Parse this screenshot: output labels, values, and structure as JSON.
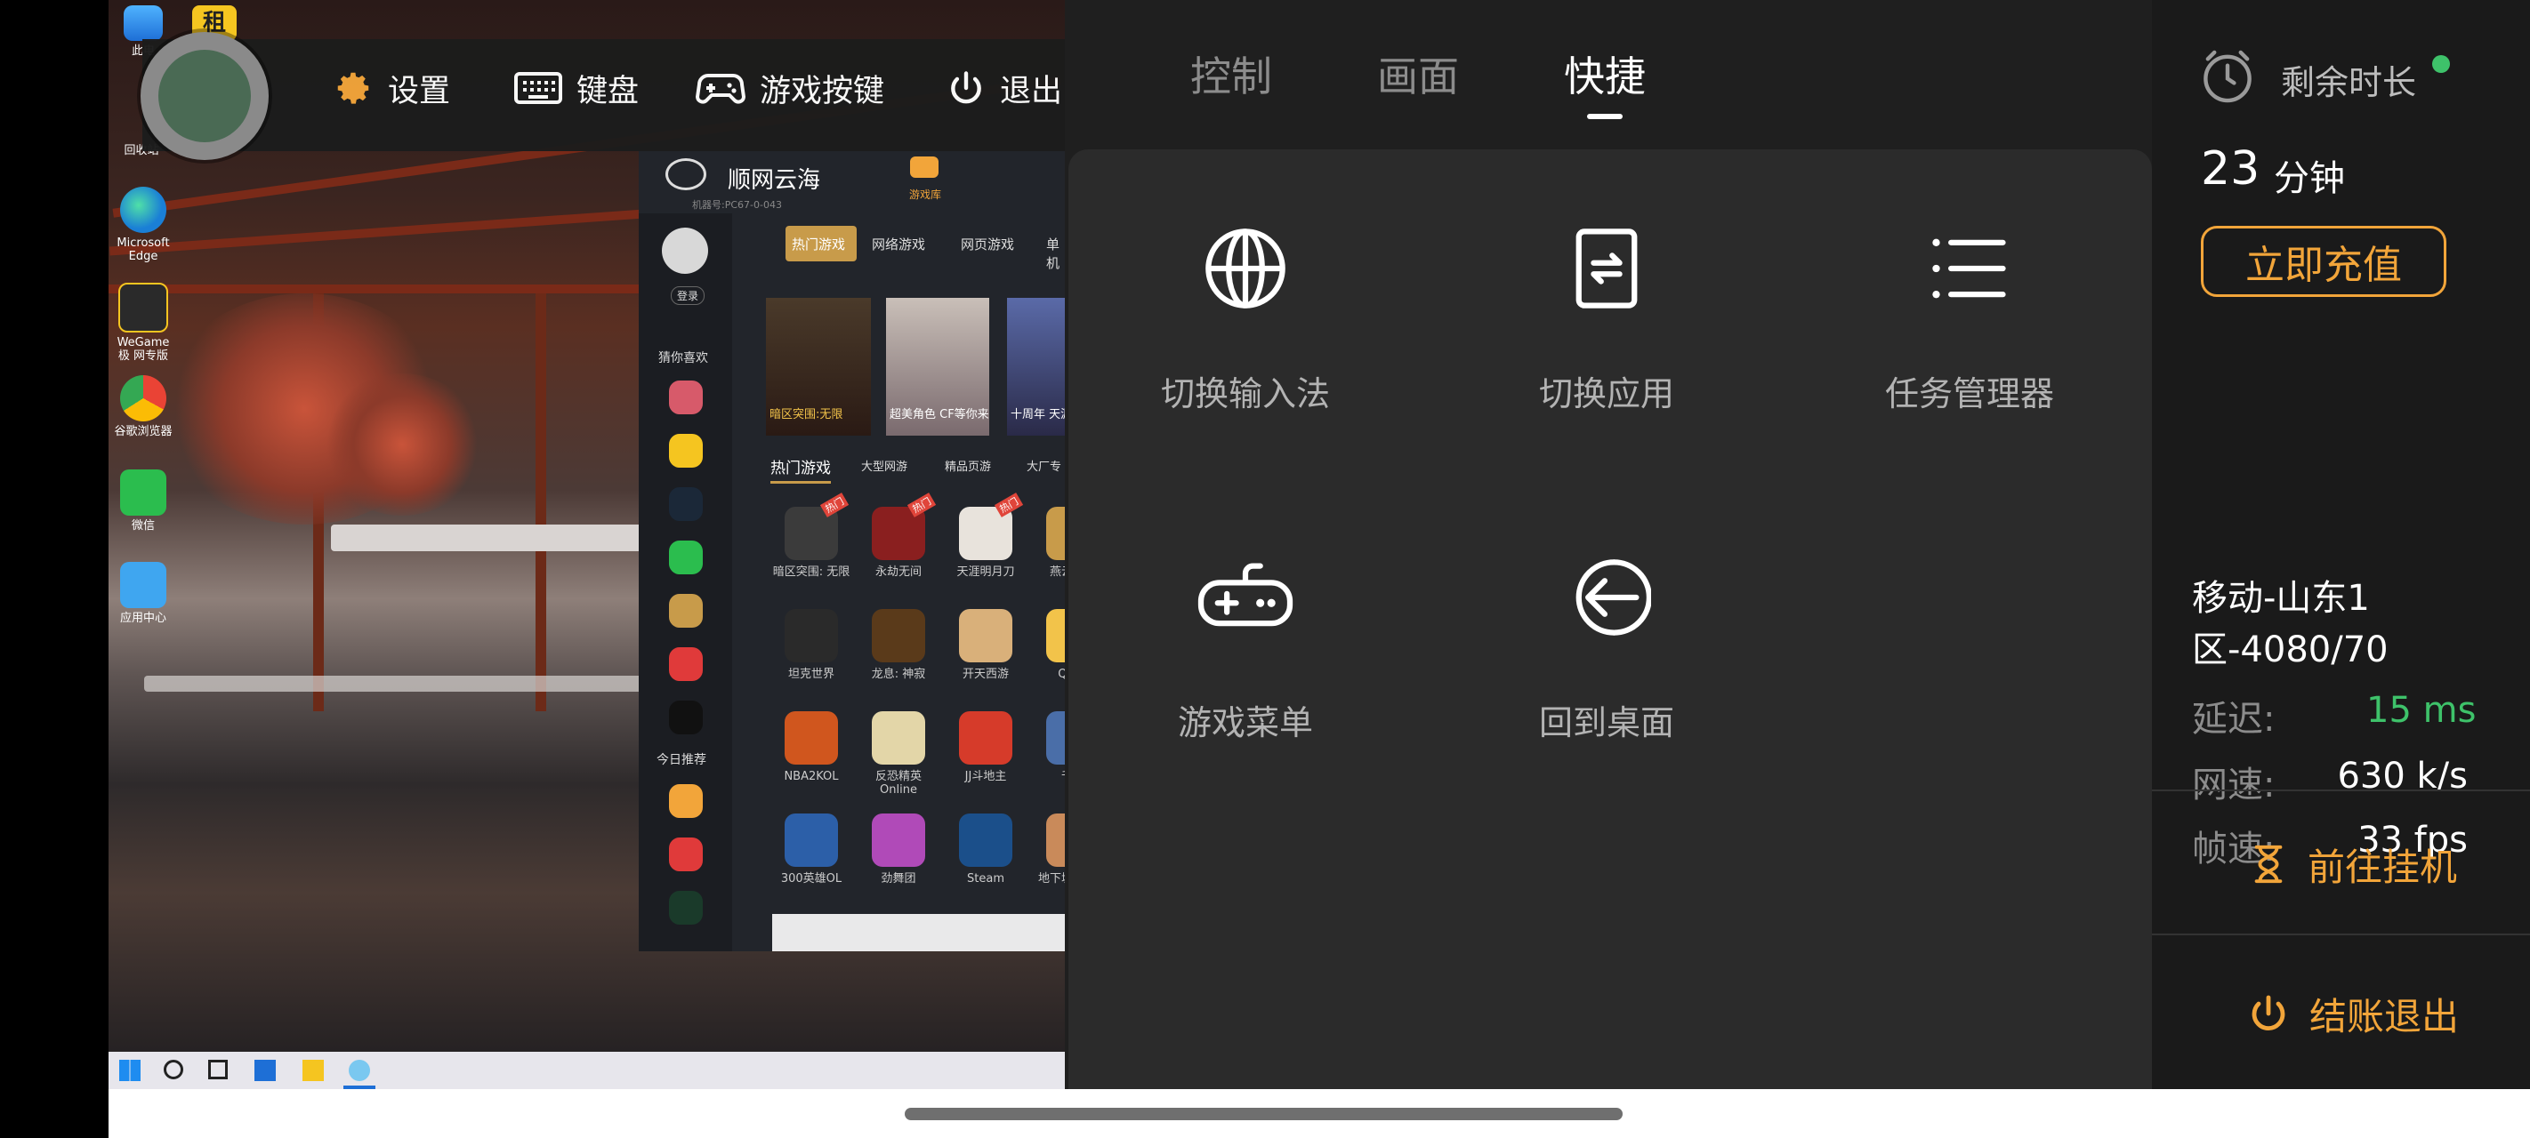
{
  "toolbar": {
    "settings": "设置",
    "keyboard": "键盘",
    "game_keys": "游戏按键",
    "exit": "退出"
  },
  "desktop": {
    "icons": [
      {
        "label": "此电",
        "icon": "computer-icon"
      },
      {
        "label": "回收站",
        "icon": "recycle-bin-icon"
      },
      {
        "label": "Microsoft Edge",
        "icon": "edge-icon"
      },
      {
        "label": "WeGame极 网专版",
        "icon": "wegame-icon"
      },
      {
        "label": "谷歌浏览器",
        "icon": "chrome-icon"
      },
      {
        "label": "微信",
        "icon": "wechat-icon"
      },
      {
        "label": "应用中心",
        "icon": "app-center-icon"
      }
    ]
  },
  "launcher": {
    "brand": "顺网云海",
    "machine": "机器号:PC67-0-043",
    "game_lib": "游戏库",
    "login": "登录",
    "guess": "猜你喜欢",
    "today": "今日推荐",
    "top_tabs": [
      "热门游戏",
      "网络游戏",
      "网页游戏",
      "单机"
    ],
    "banners": [
      "暗区突围:无限",
      "超美角色 CF等你来",
      "十周年 天涯"
    ],
    "sub_tabs": [
      "热门游戏",
      "大型网游",
      "精品页游",
      "大厂专"
    ],
    "games": [
      {
        "name": "暗区突围: 无限",
        "color": "#3b3b3b"
      },
      {
        "name": "永劫无间",
        "color": "#8a1f1f"
      },
      {
        "name": "天涯明月刀",
        "color": "#e8e3dc"
      },
      {
        "name": "燕云十六",
        "color": "#c89b4a"
      },
      {
        "name": "坦克世界",
        "color": "#2a2a2a"
      },
      {
        "name": "龙息: 神寂",
        "color": "#5a3a1a"
      },
      {
        "name": "开天西游",
        "color": "#d9b07a"
      },
      {
        "name": "QQ炫",
        "color": "#f2c34a"
      },
      {
        "name": "NBA2KOL",
        "color": "#d0561e"
      },
      {
        "name": "反恐精英 Online",
        "color": "#e3d6a8"
      },
      {
        "name": "JJ斗地主",
        "color": "#d63b2a"
      },
      {
        "name": "千军",
        "color": "#4a6ea8"
      },
      {
        "name": "300英雄OL",
        "color": "#2c5fa8"
      },
      {
        "name": "劲舞团",
        "color": "#b04ab8"
      },
      {
        "name": "Steam",
        "color": "#1b4f8a"
      },
      {
        "name": "地下城与勇士",
        "color": "#c98a5a"
      }
    ],
    "badges": [
      "热门",
      "热门",
      "热门"
    ]
  },
  "tabs": [
    "控制",
    "画面",
    "快捷"
  ],
  "tools": [
    {
      "label": "切换输入法",
      "icon": "globe-icon"
    },
    {
      "label": "切换应用",
      "icon": "switch-app-icon"
    },
    {
      "label": "任务管理器",
      "icon": "list-icon"
    },
    {
      "label": "游戏菜单",
      "icon": "gamepad-icon"
    },
    {
      "label": "回到桌面",
      "icon": "back-arrow-icon"
    }
  ],
  "account": {
    "remaining_label": "剩余时长",
    "remaining_value": "23",
    "remaining_unit": "分钟",
    "recharge": "立即充值"
  },
  "network": {
    "server": "移动-山东1区-4080/70",
    "latency_label": "延迟:",
    "latency_value": "15 ms",
    "speed_label": "网速:",
    "speed_value": "630 k/s",
    "fps_label": "帧速:",
    "fps_value": "33 fps"
  },
  "actions": {
    "idle": "前往挂机",
    "checkout": "结账退出"
  },
  "colors": {
    "accent": "#f2a53a",
    "green": "#3ec26a",
    "panel": "#1f1f1f"
  }
}
